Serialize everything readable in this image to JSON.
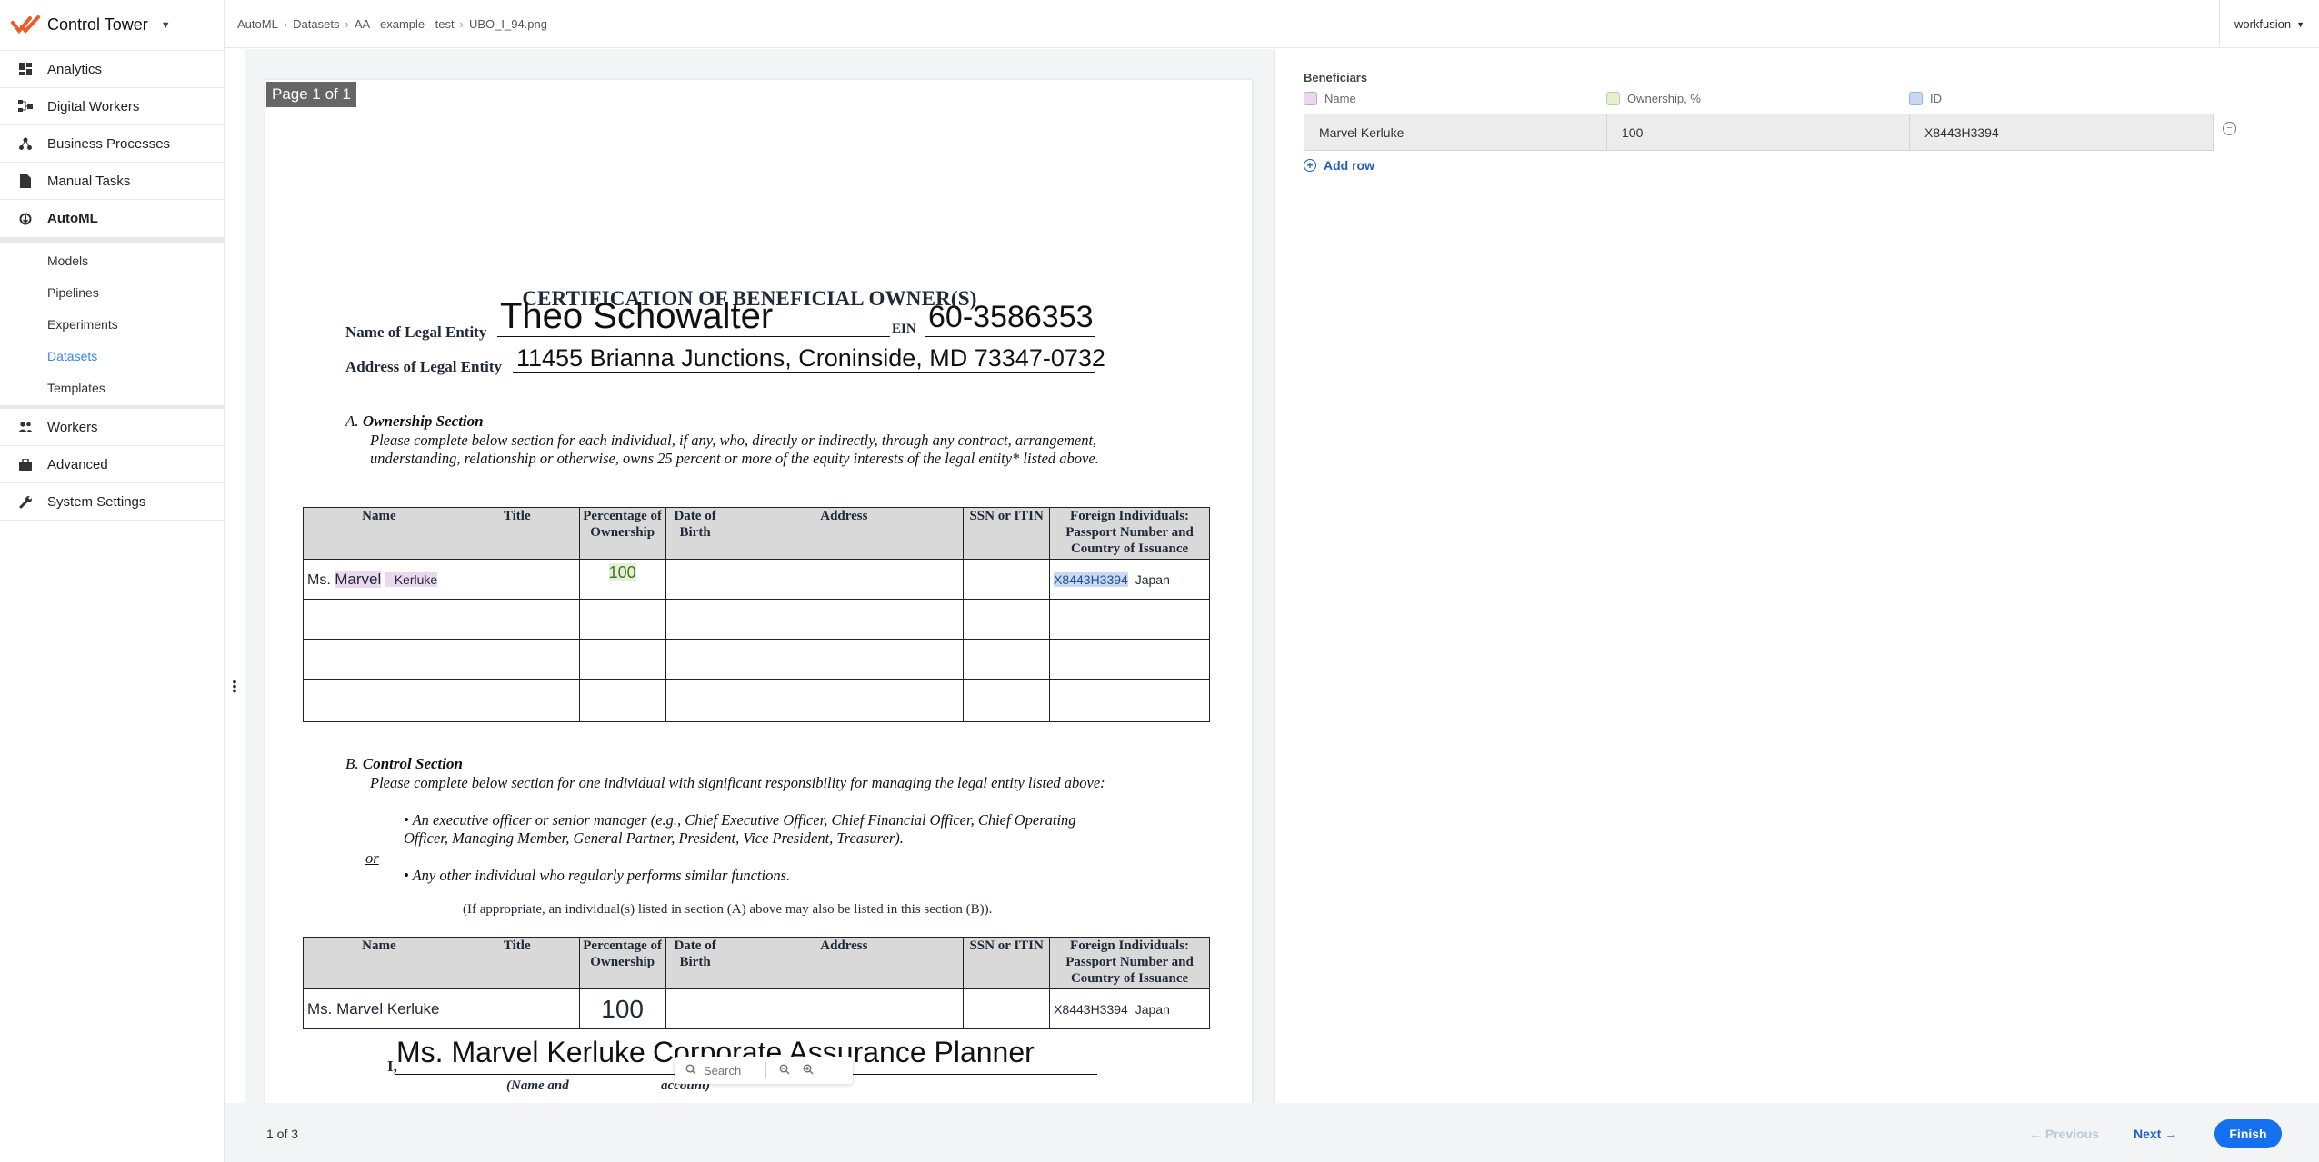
{
  "app": {
    "title": "Control Tower"
  },
  "sidebar": {
    "items": [
      {
        "label": "Analytics"
      },
      {
        "label": "Digital Workers"
      },
      {
        "label": "Business Processes"
      },
      {
        "label": "Manual Tasks"
      },
      {
        "label": "AutoML"
      }
    ],
    "automl_sub": [
      {
        "label": "Models"
      },
      {
        "label": "Pipelines"
      },
      {
        "label": "Experiments"
      },
      {
        "label": "Datasets"
      },
      {
        "label": "Templates"
      }
    ],
    "items2": [
      {
        "label": "Workers"
      },
      {
        "label": "Advanced"
      },
      {
        "label": "System Settings"
      }
    ]
  },
  "breadcrumb": [
    "AutoML",
    "Datasets",
    "AA - example - test",
    "UBO_I_94.png"
  ],
  "user": {
    "name": "workfusion"
  },
  "document": {
    "page_badge": "Page 1 of 1",
    "title": "CERTIFICATION OF BENEFICIAL OWNER(S)",
    "legal_entity_label": "Name of Legal Entity",
    "legal_entity_value": "Theo Schowalter",
    "ein_label": "EIN",
    "ein_value": "60-3586353",
    "address_label": "Address of Legal Entity",
    "address_value": "11455 Brianna Junctions, Croninside, MD 73347-0732",
    "section_a_letter": "A.",
    "section_a_title": "Ownership Section",
    "section_a_text": "Please complete below section for each individual, if any, who, directly or indirectly, through any contract, arrangement, understanding, relationship or otherwise, owns 25 percent or more of the equity interests of the legal entity* listed above.",
    "table_headers": [
      "Name",
      "Title",
      "Percentage of Ownership",
      "Date of Birth",
      "Address",
      "SSN or ITIN",
      "Foreign Individuals: Passport Number and Country of Issuance"
    ],
    "row_a": {
      "prefix": "Ms.",
      "first": "Marvel",
      "last": "Kerluke",
      "pct": "100",
      "passport": "X8443H3394",
      "country": "Japan"
    },
    "section_b_letter": "B.",
    "section_b_title": "Control Section",
    "section_b_text": "Please complete below section for one individual with significant responsibility for managing the legal entity listed above:",
    "bullet1": "• An executive officer or senior manager (e.g., Chief Executive Officer, Chief Financial Officer, Chief Operating Officer, Managing Member, General Partner, President, Vice President, Treasurer).",
    "or": "or",
    "bullet2": "• Any other individual who regularly performs similar functions.",
    "note": "(If appropriate, an individual(s) listed in section (A) above may also be listed in this section (B)).",
    "row_b": {
      "name": "Ms. Marvel Kerluke",
      "pct": "100",
      "passport": "X8443H3394",
      "country": "Japan"
    },
    "cert_prefix": "I,",
    "cert_name": "Ms. Marvel Kerluke",
    "cert_title": "Corporate Assurance Planner",
    "cert_caption_left": "(Name and",
    "cert_caption_right": "account)"
  },
  "search": {
    "placeholder": "Search"
  },
  "panel": {
    "title": "Beneficiars",
    "columns": [
      {
        "label": "Name",
        "color": "#ead8ee"
      },
      {
        "label": "Ownership, %",
        "color": "#e4efd5"
      },
      {
        "label": "ID",
        "color": "#c9d8f3"
      }
    ],
    "row": {
      "name": "Marvel Kerluke",
      "ownership": "100",
      "id": "X8443H3394"
    },
    "add_row": "Add row"
  },
  "footer": {
    "count_current": "1",
    "count_text": " of 3",
    "prev": "Previous",
    "next": "Next",
    "finish": "Finish"
  }
}
